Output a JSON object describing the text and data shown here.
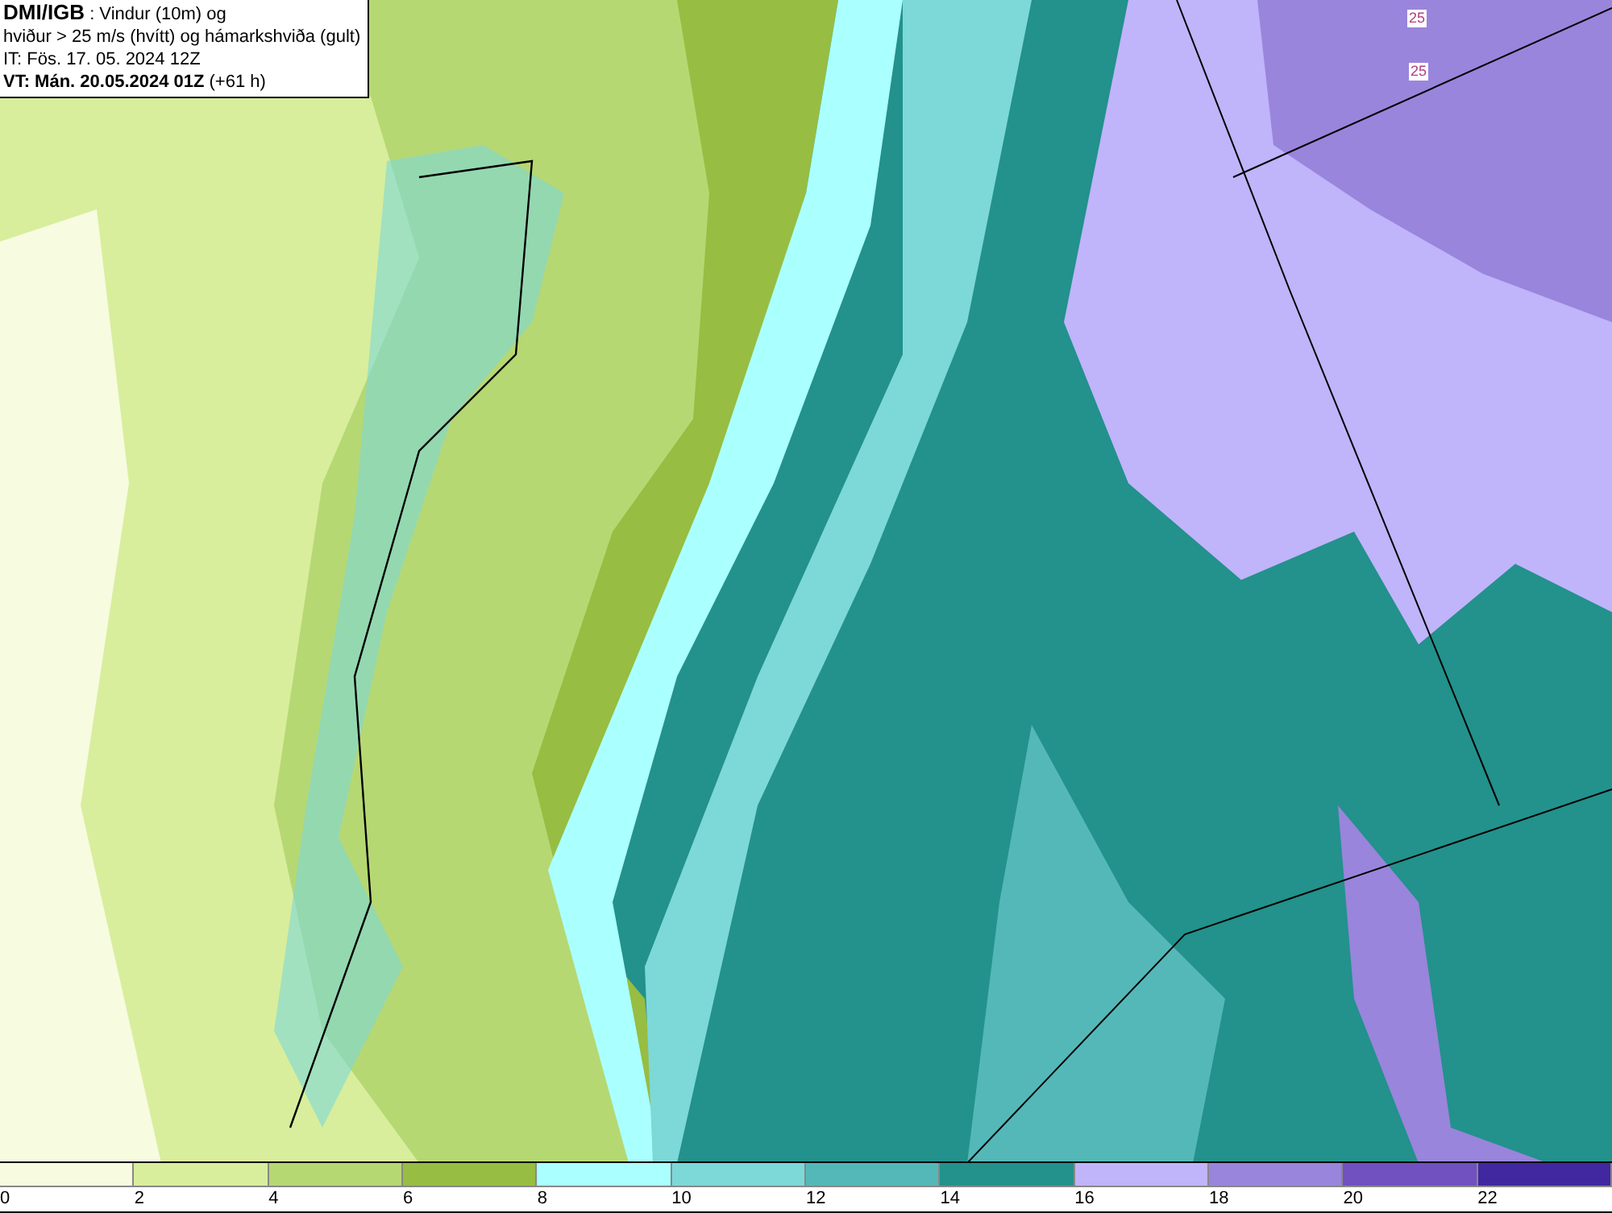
{
  "title_box": {
    "source": "DMI/IGB",
    "description": ": Vindur (10m) og",
    "line_2": "hviður > 25 m/s (hvítt) og hámarkshviða (gult)",
    "issue_time": "IT: Fös. 17. 05. 2024 12Z",
    "valid_time": "VT: Mán. 20.05.2024 01Z",
    "lead_time": "(+61 h)"
  },
  "map": {
    "contour_labels": [
      "25",
      "25"
    ]
  },
  "legend": {
    "bins": [
      {
        "label": "0",
        "color": "#f7fbe0"
      },
      {
        "label": "2",
        "color": "#d8ee9c"
      },
      {
        "label": "4",
        "color": "#b6d873"
      },
      {
        "label": "6",
        "color": "#97bd42"
      },
      {
        "label": "8",
        "color": "#aaffff"
      },
      {
        "label": "10",
        "color": "#7dd8d8"
      },
      {
        "label": "12",
        "color": "#55b8b8"
      },
      {
        "label": "14",
        "color": "#23918c"
      },
      {
        "label": "16",
        "color": "#c0b4fa"
      },
      {
        "label": "18",
        "color": "#9985dc"
      },
      {
        "label": "20",
        "color": "#7150c0"
      },
      {
        "label": "22",
        "color": "#4128a0"
      }
    ]
  }
}
